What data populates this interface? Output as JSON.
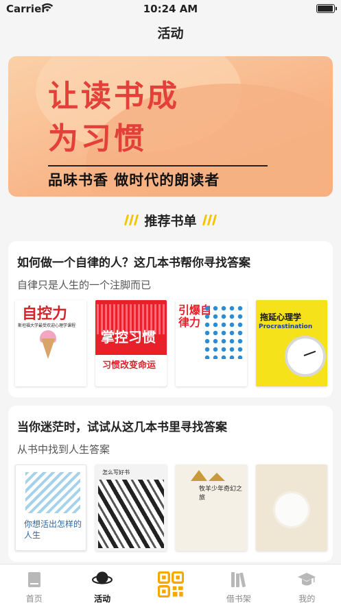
{
  "status_bar": {
    "carrier": "Carrier",
    "time": "10:24 AM",
    "battery_level": 0.95
  },
  "nav": {
    "title": "活动"
  },
  "banner": {
    "line1": "让读书成",
    "line2": "为习惯",
    "slogan": "品味书香 做时代的朗读者"
  },
  "section": {
    "title": "推荐书单"
  },
  "booklists": [
    {
      "title": "如何做一个自律的人？这几本书帮你寻找答案",
      "subtitle": "自律只是人生的一个注脚而已",
      "books": [
        {
          "cover_title": "自控力",
          "cover_sub": "斯坦福大学最受欢迎心理学课程"
        },
        {
          "cover_title": "掌控习惯",
          "cover_sub": "习惯改变命运"
        },
        {
          "cover_title": "引爆自律力"
        },
        {
          "cover_title": "拖延心理学",
          "cover_sub": "Procrastination"
        }
      ]
    },
    {
      "title": "当你迷茫时，试试从这几本书里寻找答案",
      "subtitle": "从书中找到人生答案",
      "books": [
        {
          "cover_title": "你想活出怎样的人生"
        },
        {
          "cover_title": "怎么写好书"
        },
        {
          "cover_title": "牧羊少年奇幻之旅"
        },
        {
          "cover_title": ""
        }
      ]
    }
  ],
  "tabs": [
    {
      "label": "首页",
      "icon": "book-icon",
      "active": false
    },
    {
      "label": "活动",
      "icon": "planet-icon",
      "active": true
    },
    {
      "label": "",
      "icon": "qrcode-icon",
      "active": false
    },
    {
      "label": "借书架",
      "icon": "bookshelf-icon",
      "active": false
    },
    {
      "label": "我的",
      "icon": "graduation-cap-icon",
      "active": false
    }
  ],
  "colors": {
    "accent": "#f5c400",
    "banner_text": "#e4403a",
    "tab_inactive": "#888888"
  }
}
